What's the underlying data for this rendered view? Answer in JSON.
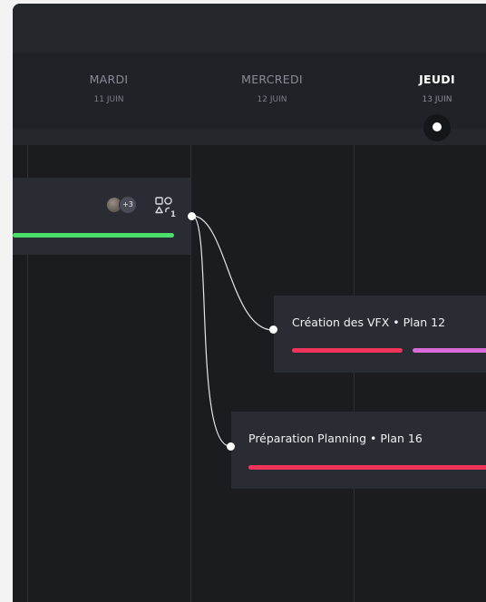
{
  "days": [
    {
      "name": "MARDI",
      "date": "11 JUIN"
    },
    {
      "name": "MERCREDI",
      "date": "12 JUIN"
    },
    {
      "name": "JEUDI",
      "date": "13 JUIN",
      "today": true
    }
  ],
  "task_top": {
    "avatar_extra_count": "+3",
    "shapes_icon": "shapes-icon",
    "shapes_count": "1",
    "progress_color": "#4ade6c"
  },
  "task_vfx": {
    "title": "Création des VFX • Plan 12",
    "bar_colors": [
      "#f0345a",
      "#d96ad8"
    ]
  },
  "task_planning": {
    "title": "Préparation Planning • Plan 16",
    "bar_colors": [
      "#f0345a"
    ]
  },
  "colors": {
    "background": "#1b1c20",
    "card": "#2a2c33",
    "accent_red": "#f0345a",
    "accent_green": "#4ade6c",
    "accent_violet": "#d96ad8"
  }
}
